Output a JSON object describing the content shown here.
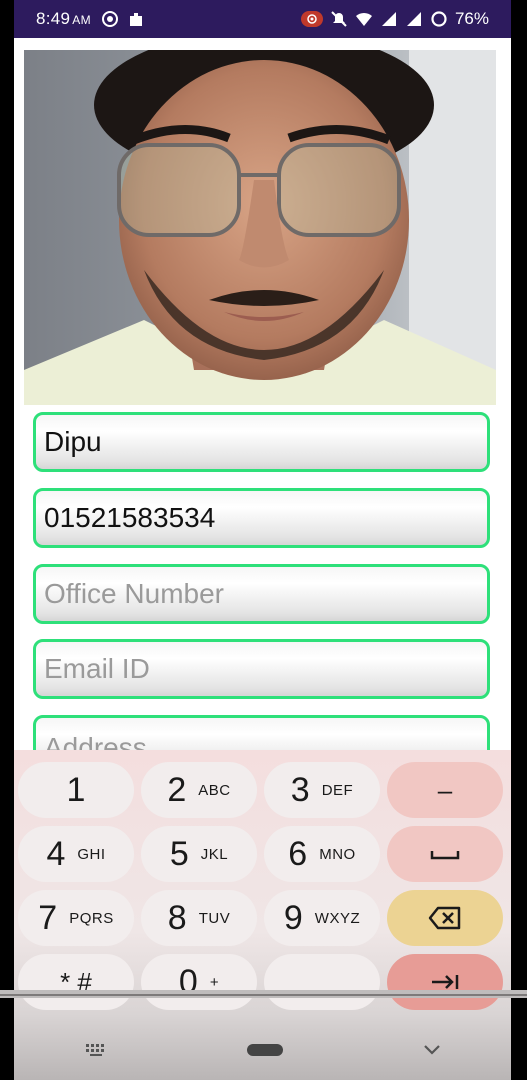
{
  "status_bar": {
    "time": "8:49",
    "ampm": "AM",
    "battery": "76%"
  },
  "form": {
    "name_value": "Dipu",
    "phone_value": "01521583534",
    "office_placeholder": "Office Number",
    "email_placeholder": "Email ID",
    "address_placeholder": "Address"
  },
  "keyboard": {
    "keys": [
      {
        "digit": "1",
        "letters": ""
      },
      {
        "digit": "2",
        "letters": "ABC"
      },
      {
        "digit": "3",
        "letters": "DEF"
      },
      {
        "digit": "4",
        "letters": "GHI"
      },
      {
        "digit": "5",
        "letters": "JKL"
      },
      {
        "digit": "6",
        "letters": "MNO"
      },
      {
        "digit": "7",
        "letters": "PQRS"
      },
      {
        "digit": "8",
        "letters": "TUV"
      },
      {
        "digit": "9",
        "letters": "WXYZ"
      },
      {
        "digit": "* #",
        "letters": ""
      },
      {
        "digit": "0",
        "letters": "+"
      },
      {
        "digit": ".",
        "letters": ""
      }
    ],
    "minus_label": "–"
  },
  "colors": {
    "status_bar": "#2d1b5e",
    "field_border": "#2ee07a",
    "key_bg": "#f2eded",
    "fn_key": "#f1c7c3",
    "delete_key": "#ecd393",
    "enter_key": "#e79c96"
  }
}
